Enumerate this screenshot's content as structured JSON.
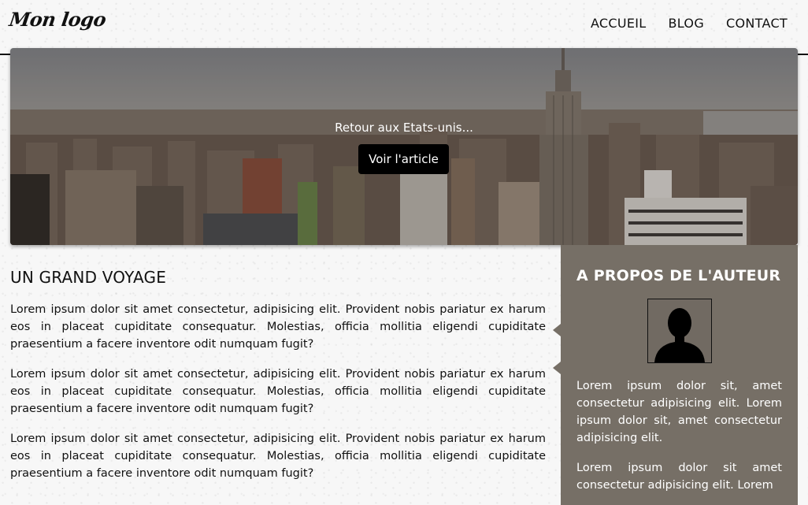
{
  "header": {
    "logo": "Mon logo",
    "nav": [
      {
        "label": "ACCUEIL"
      },
      {
        "label": "BLOG"
      },
      {
        "label": "CONTACT"
      }
    ]
  },
  "hero": {
    "caption": "Retour aux Etats-unis...",
    "button_label": "Voir l'article"
  },
  "article": {
    "title": "UN GRAND VOYAGE",
    "paragraphs": [
      "Lorem ipsum dolor sit amet consectetur, adipisicing elit. Provident nobis pariatur ex harum eos in placeat cupiditate consequatur. Molestias, officia mollitia eligendi cupiditate praesentium a facere inventore odit numquam fugit?",
      "Lorem ipsum dolor sit amet consectetur, adipisicing elit. Provident nobis pariatur ex harum eos in placeat cupiditate consequatur. Molestias, officia mollitia eligendi cupiditate praesentium a facere inventore odit numquam fugit?",
      "Lorem ipsum dolor sit amet consectetur, adipisicing elit. Provident nobis pariatur ex harum eos in placeat cupiditate consequatur. Molestias, officia mollitia eligendi cupiditate praesentium a facere inventore odit numquam fugit?"
    ]
  },
  "sidebar": {
    "title": "A PROPOS DE L'AUTEUR",
    "avatar_icon": "user-silhouette-icon",
    "paragraphs": [
      "Lorem ipsum dolor sit, amet consectetur adipisicing elit. Lorem ipsum dolor sit, amet consectetur adipisicing elit.",
      "Lorem ipsum dolor sit amet consectetur adipisicing elit. Lorem"
    ],
    "background_color": "#766f66"
  }
}
